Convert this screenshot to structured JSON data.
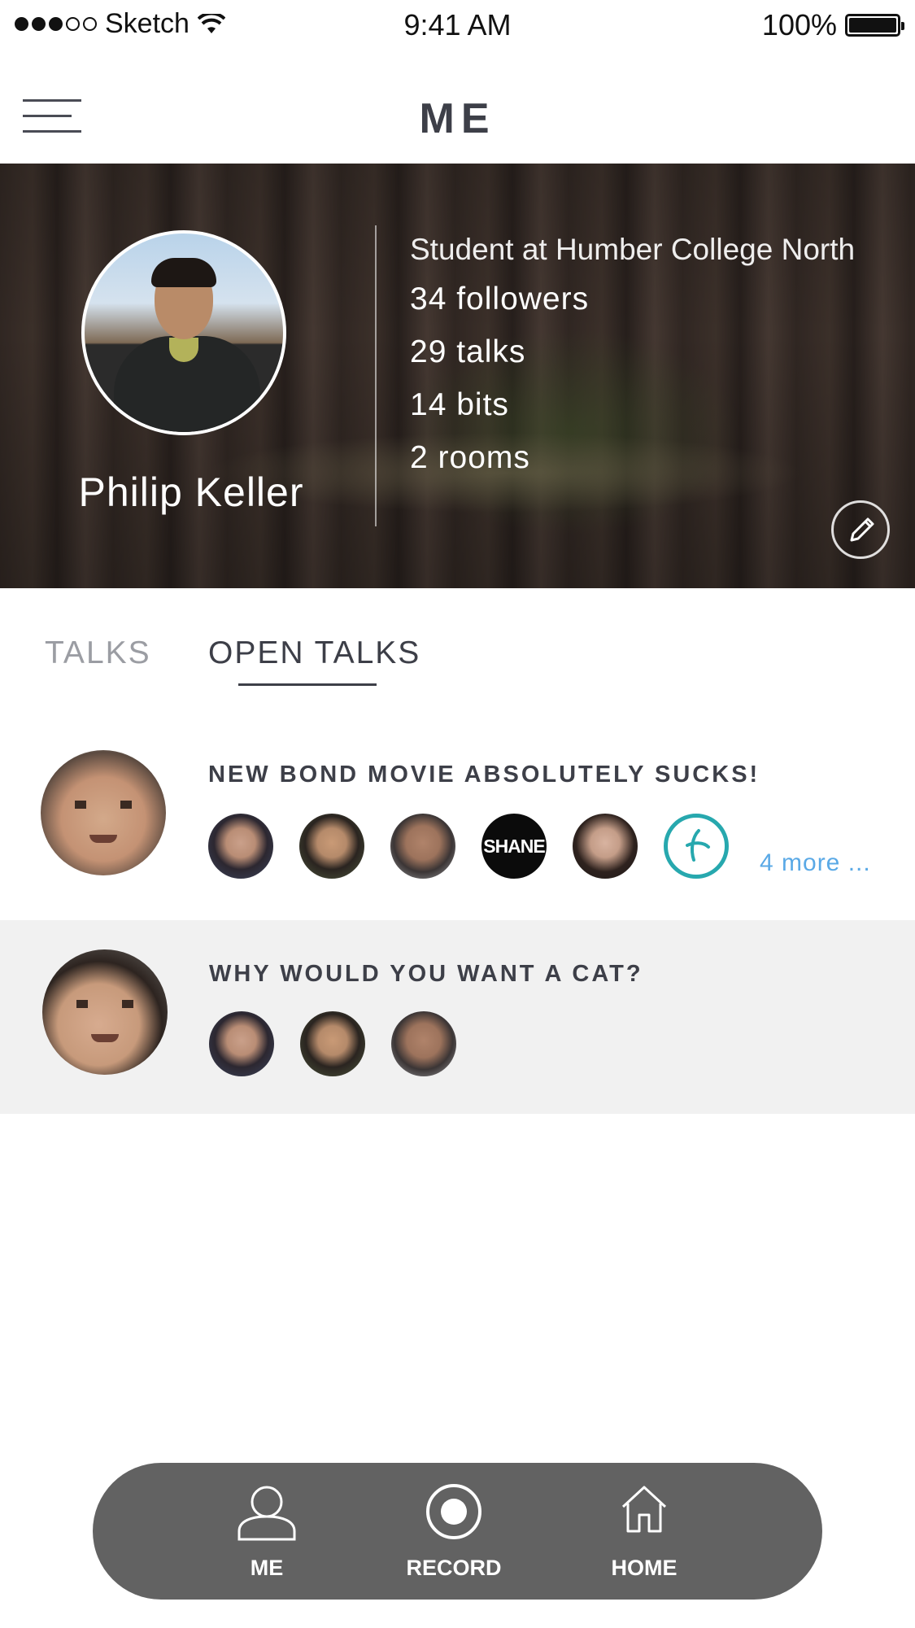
{
  "status_bar": {
    "carrier": "Sketch",
    "time": "9:41 AM",
    "battery": "100%"
  },
  "nav": {
    "title": "ME",
    "menu_icon": "hamburger-menu-icon"
  },
  "profile": {
    "name": "Philip Keller",
    "school": "Student at Humber College North",
    "followers": "34 followers",
    "talks": "29 talks",
    "bits": "14 bits",
    "rooms": "2 rooms",
    "edit_icon": "pencil-icon"
  },
  "tabs": [
    {
      "label": "TALKS",
      "active": false
    },
    {
      "label": "OPEN TALKS",
      "active": true
    }
  ],
  "talks": [
    {
      "title": "NEW BOND MOVIE ABSOLUTELY SUCKS!",
      "participant_count_shown": 6,
      "participant_logo_text": "SHANE",
      "more_label": "4 more ..."
    },
    {
      "title": "WHY WOULD YOU WANT A CAT?",
      "participant_count_shown": 3
    }
  ],
  "bottom_bar": {
    "items": [
      {
        "label": "ME",
        "icon": "person-icon"
      },
      {
        "label": "RECORD",
        "icon": "record-icon"
      },
      {
        "label": "HOME",
        "icon": "home-icon"
      }
    ],
    "background": "#626262"
  },
  "colors": {
    "text_dark": "#3d3f48",
    "tab_inactive": "#9b9da3",
    "link_blue": "#5aa9e6",
    "accent_teal": "#27a8ae",
    "row_highlight": "#f1f1f1"
  }
}
